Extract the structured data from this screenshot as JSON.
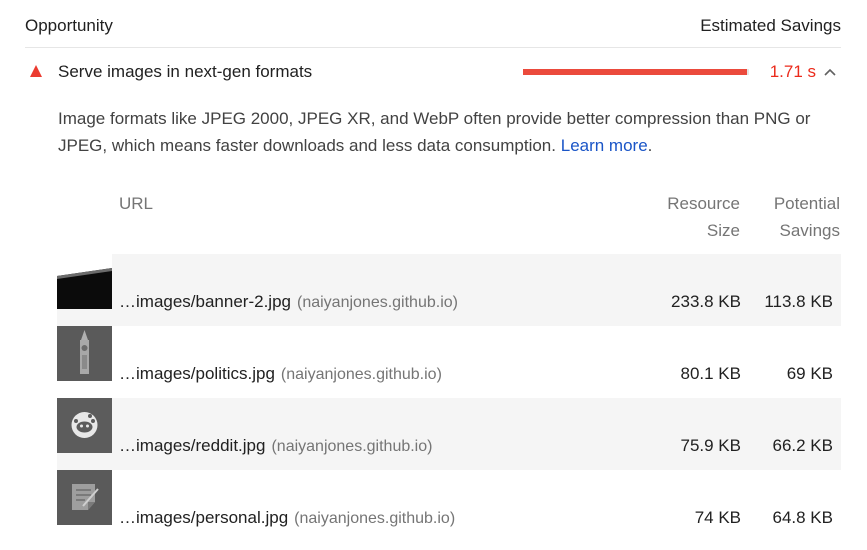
{
  "header": {
    "opportunity_label": "Opportunity",
    "savings_label": "Estimated Savings"
  },
  "audit": {
    "title": "Serve images in next-gen formats",
    "savings": "1.71 s",
    "savings_fraction": 0.99,
    "status_color": "#eb3b30",
    "description": "Image formats like JPEG 2000, JPEG XR, and WebP often provide better compression than PNG or JPEG, which means faster downloads and less data consumption.",
    "learn_more": "Learn more",
    "period": "."
  },
  "table": {
    "headers": {
      "url": "URL",
      "resource_size_line1": "Resource",
      "resource_size_line2": "Size",
      "potential_line1": "Potential",
      "potential_line2": "Savings"
    },
    "rows": [
      {
        "url": "…images/banner-2.jpg",
        "host": "(naiyanjones.github.io)",
        "size": "233.8 KB",
        "savings": "113.8 KB",
        "thumb_icon": "banner-thumbnail"
      },
      {
        "url": "…images/politics.jpg",
        "host": "(naiyanjones.github.io)",
        "size": "80.1 KB",
        "savings": "69 KB",
        "thumb_icon": "big-ben-thumbnail"
      },
      {
        "url": "…images/reddit.jpg",
        "host": "(naiyanjones.github.io)",
        "size": "75.9 KB",
        "savings": "66.2 KB",
        "thumb_icon": "reddit-thumbnail"
      },
      {
        "url": "…images/personal.jpg",
        "host": "(naiyanjones.github.io)",
        "size": "74 KB",
        "savings": "64.8 KB",
        "thumb_icon": "notepad-thumbnail"
      }
    ]
  }
}
